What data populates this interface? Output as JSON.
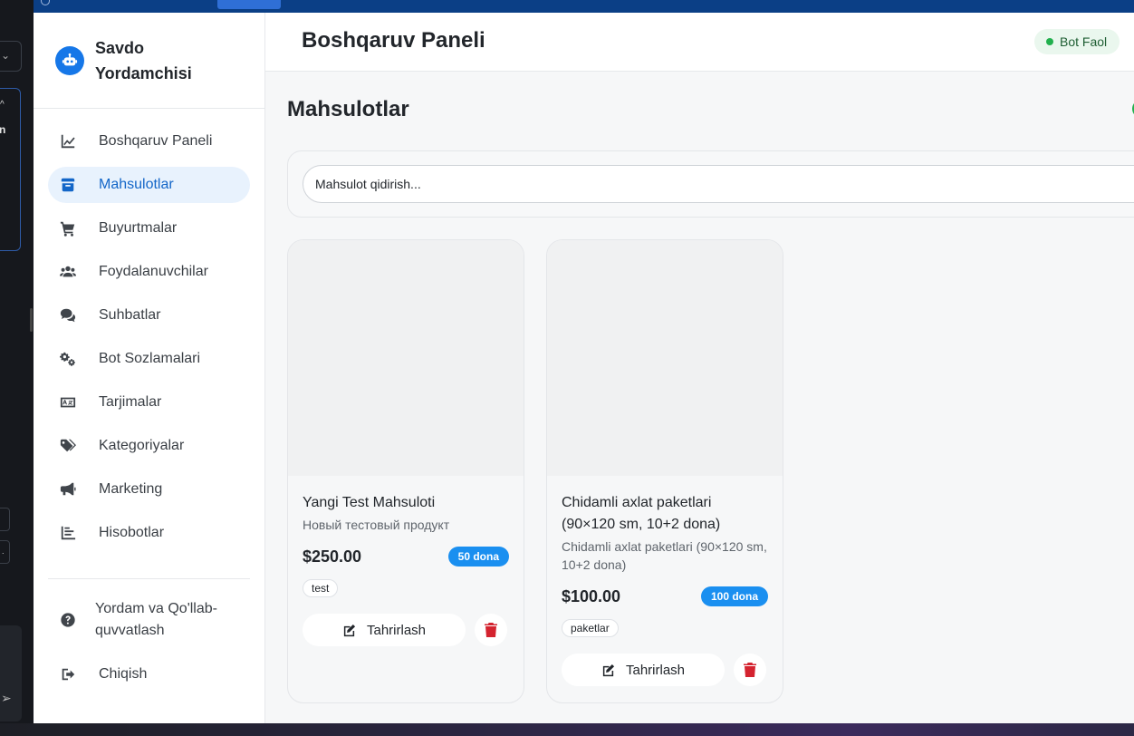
{
  "app": {
    "brand_title": "Savdo Yordamchisi",
    "header_title": "Boshqaruv Paneli",
    "status_label": "Bot Faol"
  },
  "colors": {
    "accent": "#1677e8",
    "active_bg": "#e8f2fd",
    "status_green": "#22b04e",
    "stock_badge": "#1a8ff0",
    "danger": "#d4232f"
  },
  "sidebar": {
    "items": [
      {
        "label": "Boshqaruv Paneli",
        "icon": "chart-line-icon"
      },
      {
        "label": "Mahsulotlar",
        "icon": "box-icon",
        "active": true
      },
      {
        "label": "Buyurtmalar",
        "icon": "cart-icon"
      },
      {
        "label": "Foydalanuvchilar",
        "icon": "users-icon"
      },
      {
        "label": "Suhbatlar",
        "icon": "chat-icon"
      },
      {
        "label": "Bot Sozlamalari",
        "icon": "gears-icon"
      },
      {
        "label": "Tarjimalar",
        "icon": "language-icon"
      },
      {
        "label": "Kategoriyalar",
        "icon": "tags-icon"
      },
      {
        "label": "Marketing",
        "icon": "megaphone-icon"
      },
      {
        "label": "Hisobotlar",
        "icon": "bar-chart-icon"
      }
    ],
    "help_label": "Yordam va Qo'llab-quvvatlash",
    "logout_label": "Chiqish"
  },
  "products_page": {
    "title": "Mahsulotlar",
    "search_placeholder": "Mahsulot qidirish...",
    "edit_label": "Tahrirlash",
    "products": [
      {
        "name": "Yangi Test Mahsuloti",
        "description": "Новый тестовый продукт",
        "price": "$250.00",
        "stock": "50 dona",
        "tag": "test"
      },
      {
        "name": "Chidamli axlat paketlari (90×120 sm, 10+2 dona)",
        "description": "Chidamli axlat paketlari (90×120 sm, 10+2 dona)",
        "price": "$100.00",
        "stock": "100 dona",
        "tag": "paketlar"
      }
    ]
  }
}
